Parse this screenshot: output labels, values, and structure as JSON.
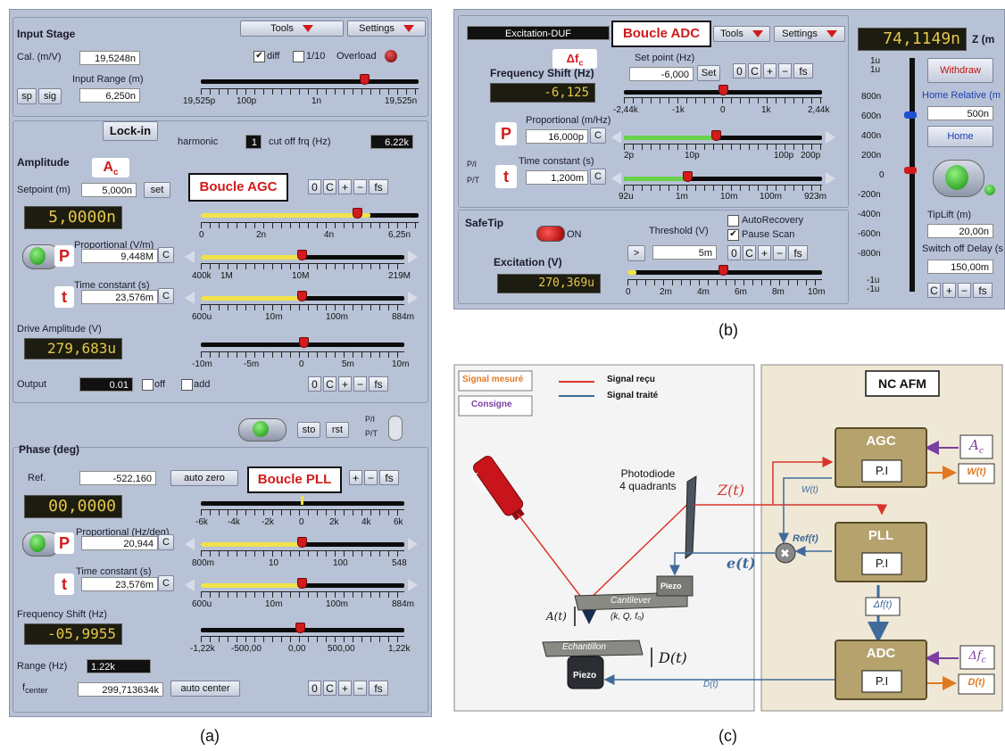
{
  "panel_a": {
    "caption": "(a)",
    "tools": "Tools",
    "settings": "Settings",
    "input_stage": {
      "title": "Input Stage",
      "cal_label": "Cal. (m/V)",
      "cal_value": "19,5248n",
      "diff_label": "diff",
      "diff_checked": true,
      "div10_label": "1/10",
      "overload_label": "Overload",
      "range_label": "Input Range (m)",
      "range_value": "6,250n",
      "sp": "sp",
      "sig": "sig",
      "ticks": [
        "19,525p",
        "100p",
        "1n",
        "19,525n"
      ],
      "slider_fraction": 0.9
    },
    "lockin": {
      "title": "Lock-in",
      "harmonic_label": "harmonic",
      "harmonic_value": "1",
      "cutoff_label": "cut off frq (Hz)",
      "cutoff_value": "6.22k"
    },
    "amplitude": {
      "tab": "Amplitude",
      "ac_tag": "A",
      "ac_sub": "c",
      "setpoint_label": "Setpoint (m)",
      "setpoint_value": "5,000n",
      "set": "set",
      "boucle_tag": "Boucle AGC",
      "lcd": "5,0000n",
      "setpoint_ticks": [
        "0",
        "2n",
        "4n",
        "6,25n"
      ],
      "setpoint_fraction": 0.8,
      "p_tag": "P",
      "prop_label": "Proportional (V/m)",
      "prop_value": "9,448M",
      "prop_ticks": [
        "400k",
        "1M",
        "10M",
        "219M"
      ],
      "prop_fraction": 0.48,
      "t_tag": "t",
      "tc_label": "Time constant (s)",
      "tc_value": "23,576m",
      "tc_ticks": [
        "600u",
        "10m",
        "100m",
        "884m"
      ],
      "tc_fraction": 0.48,
      "drive_label": "Drive Amplitude (V)",
      "drive_lcd": "279,683u",
      "drive_ticks": [
        "-10m",
        "-5m",
        "0",
        "5m",
        "10m"
      ],
      "drive_fraction": 0.5,
      "output_label": "Output",
      "output_value": "0.01",
      "off_label": "off",
      "add_label": "add",
      "c": "C"
    },
    "mid_row": {
      "sto": "sto",
      "rst": "rst",
      "pi": "P/I",
      "pt": "P/T"
    },
    "phase": {
      "tab": "Phase (deg)",
      "ref_label": "Ref.",
      "ref_value": "-522,160",
      "auto_zero": "auto zero",
      "boucle_tag": "Boucle PLL",
      "lcd": "00,0000",
      "ref_ticks": [
        "-6k",
        "-4k",
        "-2k",
        "0",
        "2k",
        "4k",
        "6k"
      ],
      "p_tag": "P",
      "prop_label": "Proportional (Hz/deg)",
      "prop_value": "20,944",
      "prop_ticks": [
        "800m",
        "10",
        "100",
        "548"
      ],
      "prop_fraction": 0.48,
      "t_tag": "t",
      "tc_label": "Time constant (s)",
      "tc_value": "23,576m",
      "tc_ticks": [
        "600u",
        "10m",
        "100m",
        "884m"
      ],
      "tc_fraction": 0.48,
      "fs_label": "Frequency Shift (Hz)",
      "fs_lcd": "-05,9955",
      "fs_ticks": [
        "-1,22k",
        "-500,00",
        "0,00",
        "500,00",
        "1,22k"
      ],
      "fs_fraction": 0.48,
      "range_label": "Range (Hz)",
      "range_value": "1.22k",
      "fcenter_label": "f",
      "fcenter_sub": "center",
      "fcenter_value": "299,713634k",
      "auto_center": "auto center"
    },
    "small_btns": [
      "0",
      "C",
      "+",
      "−",
      "fs"
    ]
  },
  "panel_b": {
    "caption": "(b)",
    "title_field": "Excitation-DUF",
    "boucle_tag": "Boucle ADC",
    "tools": "Tools",
    "settings": "Settings",
    "z_lcd": "74,1149n",
    "z_label": "Z (m",
    "df_tag": "Δf",
    "df_sub": "c",
    "setpoint_label": "Set point (Hz)",
    "setpoint_value": "-6,000",
    "set": "Set",
    "fs_label": "Frequency Shift (Hz)",
    "fs_lcd": "-6,125",
    "setpoint_ticks": [
      "-2,44k",
      "-1k",
      "0",
      "1k",
      "2,44k"
    ],
    "setpoint_fraction": 0.5,
    "p_tag": "P",
    "prop_label": "Proportional (m/Hz)",
    "prop_value": "16,000p",
    "prop_ticks": [
      "2p",
      "10p",
      "100p",
      "200p"
    ],
    "prop_fraction": 0.45,
    "pi": "P/I",
    "pt": "P/T",
    "t_tag": "t",
    "tc_label": "Time constant (s)",
    "tc_value": "1,200m",
    "tc_ticks": [
      "92u",
      "1m",
      "10m",
      "100m",
      "923m"
    ],
    "tc_fraction": 0.32,
    "safetip": "SafeTip",
    "on": "ON",
    "threshold_label": "Threshold (V)",
    "threshold_value": "5m",
    "autorecovery": "AutoRecovery",
    "pause_scan": "Pause Scan",
    "excitation_label": "Excitation (V)",
    "excitation_lcd": "270,369u",
    "exc_ticks": [
      "0",
      "2m",
      "4m",
      "6m",
      "8m",
      "10m"
    ],
    "exc_fraction": 0.5,
    "withdraw": "Withdraw",
    "home_relative": "Home Relative (m",
    "home_rel_value": "500n",
    "home": "Home",
    "z_ticks": [
      "1u",
      "1u",
      "800n",
      "600n",
      "400n",
      "200n",
      "0",
      "-200n",
      "-400n",
      "-600n",
      "-800n",
      "-1u",
      "-1u"
    ],
    "tiplift_label": "TipLift (m)",
    "tiplift_value": "20,00n",
    "switchoff_label": "Switch off Delay (s",
    "switchoff_value": "150,00m",
    "small_btns": [
      "0",
      "C",
      "+",
      "−",
      "fs"
    ],
    "small_btns3": [
      "C",
      "+",
      "−",
      "fs"
    ]
  },
  "panel_c": {
    "caption": "(c)",
    "legend_mesure": "Signal mesuré",
    "legend_consigne": "Consigne",
    "legend_recu": "Signal reçu",
    "legend_traite": "Signal traité",
    "nc_afm": "NC AFM",
    "laser": "laser",
    "photodiode": "Photodiode\n4 quadrants",
    "z_t": "Z(t)",
    "e_t": "e(t)",
    "a_t": "A(t)",
    "d_t": "D(t)",
    "d_t_small": "D(t)",
    "cantilever": "Cantilever",
    "cant_params": "(k, Q, f₀)",
    "piezo": "Piezo",
    "echantillon": "Echantillon",
    "agc": "AGC",
    "pll": "PLL",
    "adc": "ADC",
    "pi": "P.I",
    "w_t": "W(t)",
    "ref_t": "Ref(t)",
    "delta_f": "Δf(t)",
    "ac": "A",
    "ac_sub": "c",
    "dfc": "Δf",
    "dfc_sub": "c",
    "colors": {
      "red": "#d9342b",
      "blue": "#3f6a9a",
      "purple": "#7a3fa0",
      "orange": "#e07a22",
      "box": "#b5a26d"
    }
  }
}
